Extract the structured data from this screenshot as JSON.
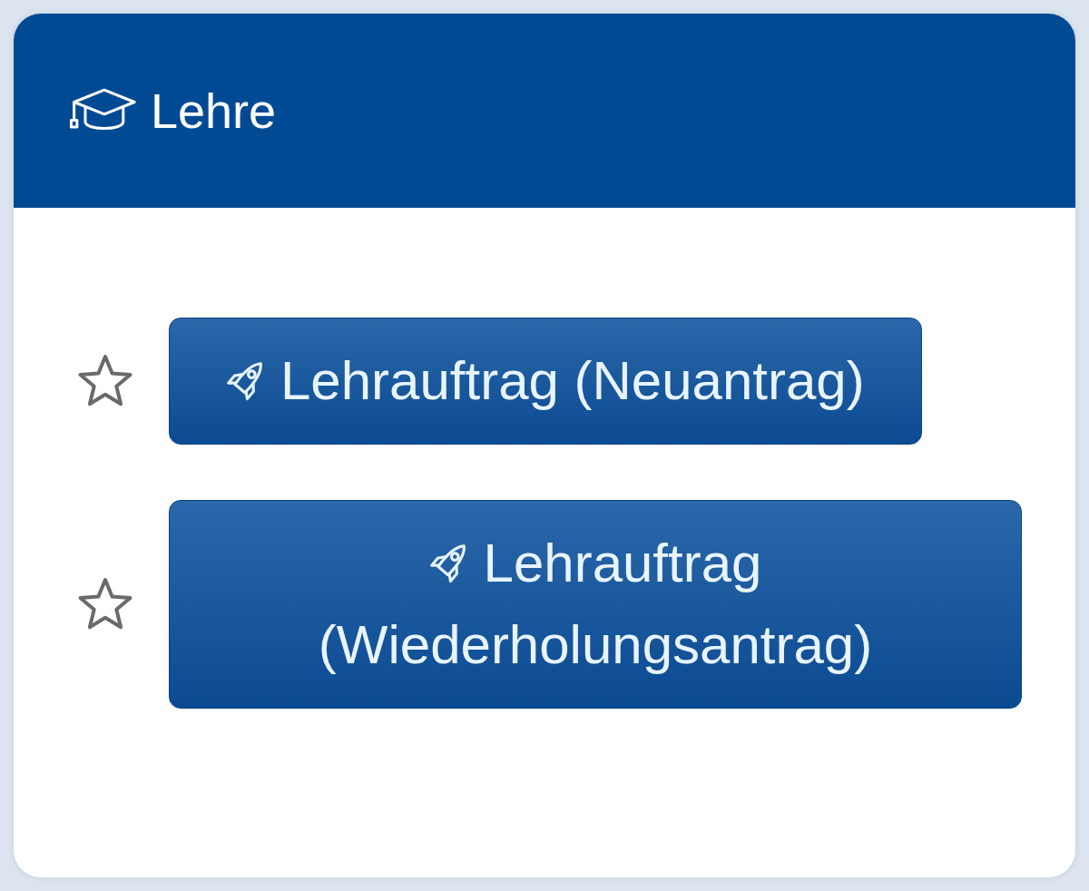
{
  "card": {
    "title": "Lehre",
    "actions": [
      {
        "label": "Lehrauftrag (Neuantrag)",
        "favorite": false
      },
      {
        "label": "Lehrauftrag (Wiederholungsantrag)",
        "favorite": false
      }
    ]
  }
}
